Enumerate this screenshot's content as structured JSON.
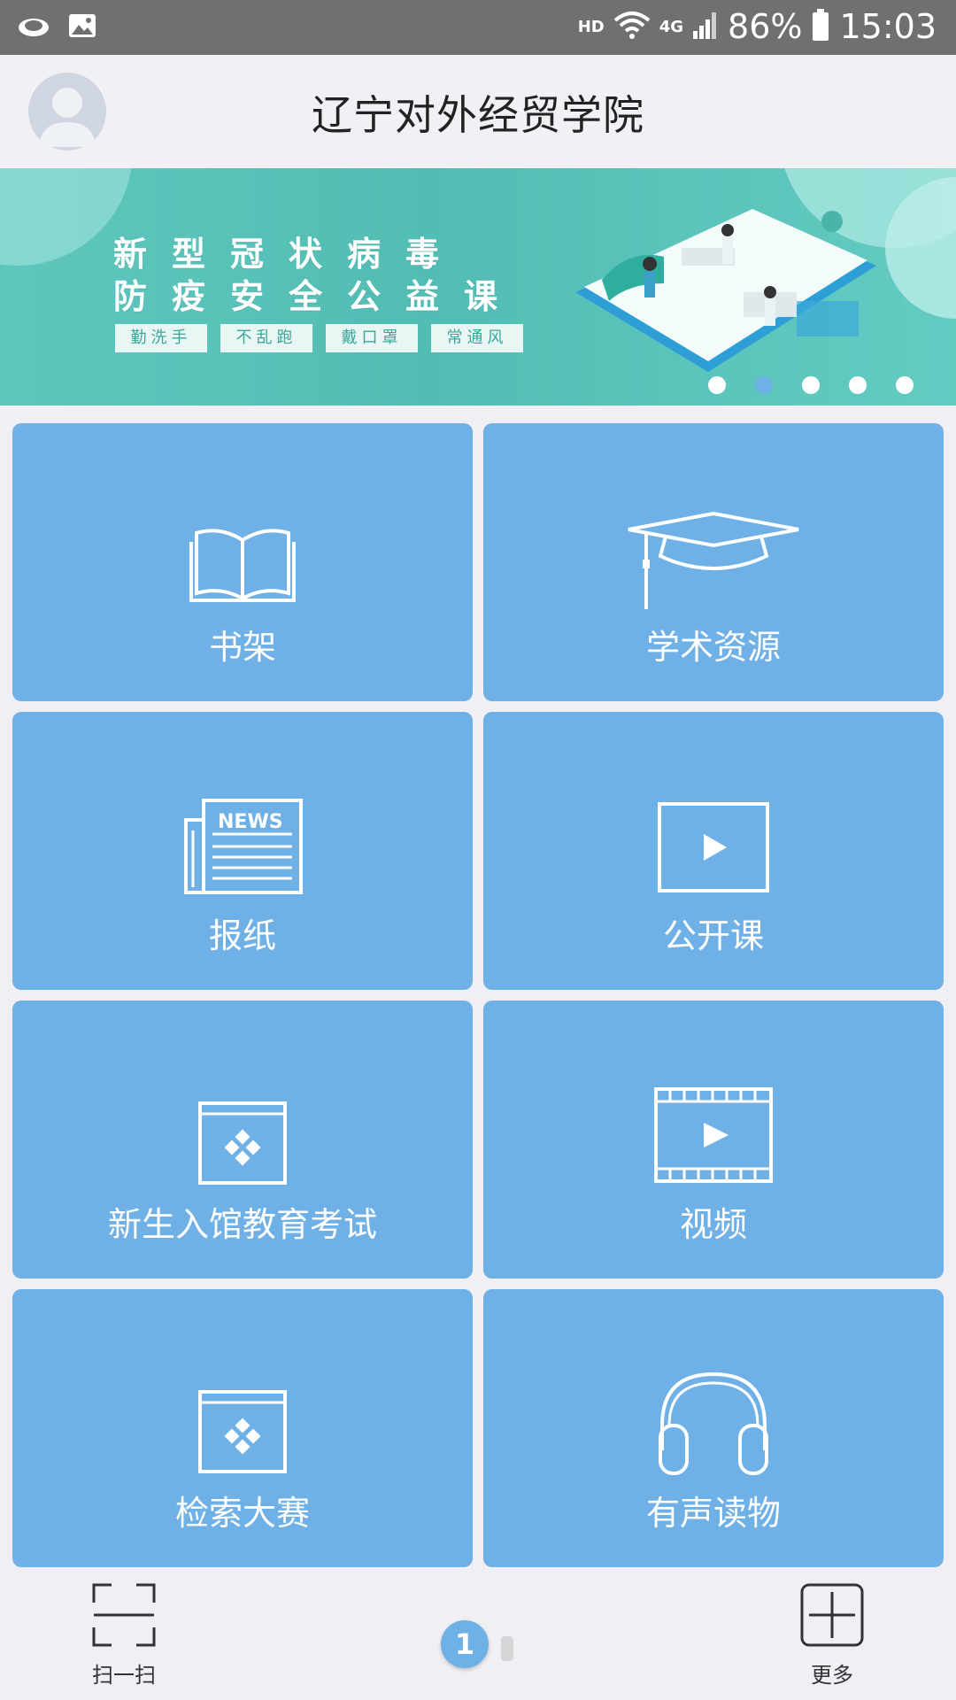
{
  "status_bar": {
    "hd": "HD",
    "network": "4G",
    "battery": "86%",
    "time": "15:03"
  },
  "header": {
    "title": "辽宁对外经贸学院"
  },
  "banner": {
    "line1": "新型冠状病毒",
    "line2": "防疫安全公益课",
    "tags": [
      "勤洗手",
      "不乱跑",
      "戴口罩",
      "常通风"
    ],
    "slides": 5,
    "active_slide": 2
  },
  "grid": {
    "items": [
      {
        "label": "书架",
        "icon": "book-icon"
      },
      {
        "label": "学术资源",
        "icon": "graduation-cap-icon"
      },
      {
        "label": "报纸",
        "icon": "newspaper-icon"
      },
      {
        "label": "公开课",
        "icon": "play-screen-icon"
      },
      {
        "label": "新生入馆教育考试",
        "icon": "app-window-icon"
      },
      {
        "label": "视频",
        "icon": "film-icon"
      },
      {
        "label": "检索大赛",
        "icon": "app-window-icon"
      },
      {
        "label": "有声读物",
        "icon": "headphones-icon"
      }
    ],
    "news_text": "NEWS"
  },
  "bottom_bar": {
    "scan_label": "扫一扫",
    "page_number": "1",
    "more_label": "更多"
  },
  "colors": {
    "tile": "#6fb1e6",
    "status_bar": "#707070",
    "banner": "#52bdb4",
    "accent": "#6db1e6"
  }
}
